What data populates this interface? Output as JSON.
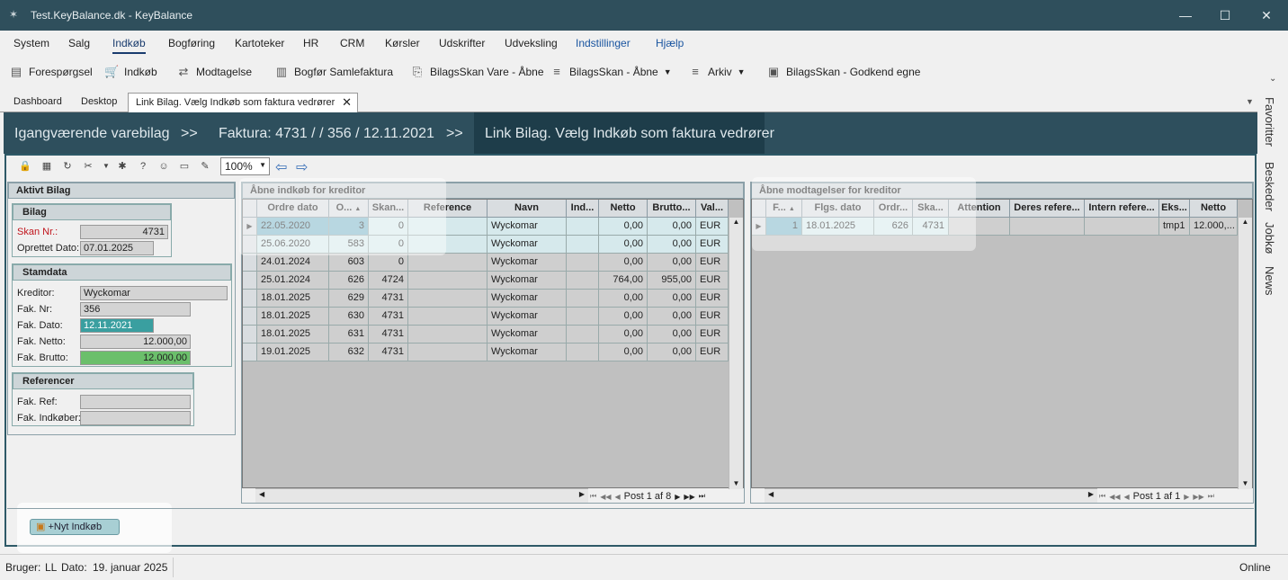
{
  "window": {
    "title": "Test.KeyBalance.dk - KeyBalance"
  },
  "menu": [
    "System",
    "Salg",
    "Indkøb",
    "Bogføring",
    "Kartoteker",
    "HR",
    "CRM",
    "Kørsler",
    "Udskrifter",
    "Udveksling",
    "Indstillinger",
    "Hjælp"
  ],
  "toolbar": [
    "Forespørgsel",
    "Indkøb",
    "Modtagelse",
    "Bogfør Samlefaktura",
    "BilagsSkan Vare - Åbne",
    "BilagsSkan - Åbne",
    "Arkiv",
    "BilagsSkan - Godkend egne"
  ],
  "tabs": [
    "Dashboard",
    "Desktop",
    "Link Bilag. Vælg Indkøb som faktura vedrører"
  ],
  "breadcrumb": {
    "b1": "Igangværende varebilag",
    "sep": ">>",
    "b2": "Faktura: 4731 /  / 356 / 12.11.2021",
    "b3": "Link Bilag. Vælg Indkøb som faktura vedrører"
  },
  "zoom": "100%",
  "left": {
    "title": "Aktivt Bilag",
    "bilag": {
      "header": "Bilag",
      "skan_label": "Skan Nr.:",
      "skan_value": "4731",
      "oprettet_label": "Oprettet Dato:",
      "oprettet_value": "07.01.2025"
    },
    "stamdata": {
      "header": "Stamdata",
      "kreditor_label": "Kreditor:",
      "kreditor_value": "Wyckomar",
      "faknr_label": "Fak. Nr:",
      "faknr_value": "356",
      "fakdato_label": "Fak. Dato:",
      "fakdato_value": "12.11.2021",
      "faknetto_label": "Fak. Netto:",
      "faknetto_value": "12.000,00",
      "fakbrutto_label": "Fak. Brutto:",
      "fakbrutto_value": "12.000,00"
    },
    "referencer": {
      "header": "Referencer",
      "ref_label": "Fak. Ref:",
      "ref_value": "",
      "indkober_label": "Fak. Indkøber:",
      "indkober_value": ""
    }
  },
  "grid1": {
    "title": "Åbne indkøb for kreditor",
    "headers": [
      "Ordre dato",
      "O...",
      "Skan...",
      "Reference",
      "Navn",
      "Ind...",
      "Netto",
      "Brutto...",
      "Val..."
    ],
    "rows": [
      [
        "22.05.2020",
        "3",
        "0",
        "",
        "Wyckomar",
        "",
        "0,00",
        "0,00",
        "EUR"
      ],
      [
        "25.06.2020",
        "583",
        "0",
        "",
        "Wyckomar",
        "",
        "0,00",
        "0,00",
        "EUR"
      ],
      [
        "24.01.2024",
        "603",
        "0",
        "",
        "Wyckomar",
        "",
        "0,00",
        "0,00",
        "EUR"
      ],
      [
        "25.01.2024",
        "626",
        "4724",
        "",
        "Wyckomar",
        "",
        "764,00",
        "955,00",
        "EUR"
      ],
      [
        "18.01.2025",
        "629",
        "4731",
        "",
        "Wyckomar",
        "",
        "0,00",
        "0,00",
        "EUR"
      ],
      [
        "18.01.2025",
        "630",
        "4731",
        "",
        "Wyckomar",
        "",
        "0,00",
        "0,00",
        "EUR"
      ],
      [
        "18.01.2025",
        "631",
        "4731",
        "",
        "Wyckomar",
        "",
        "0,00",
        "0,00",
        "EUR"
      ],
      [
        "19.01.2025",
        "632",
        "4731",
        "",
        "Wyckomar",
        "",
        "0,00",
        "0,00",
        "EUR"
      ]
    ],
    "pager": "Post 1 af 8"
  },
  "grid2": {
    "title": "Åbne modtagelser for kreditor",
    "headers": [
      "F...",
      "Flgs. dato",
      "Ordr...",
      "Ska...",
      "Attention",
      "Deres refere...",
      "Intern refere...",
      "Eks...",
      "Netto"
    ],
    "rows": [
      [
        "1",
        "18.01.2025",
        "626",
        "4731",
        "",
        "",
        "",
        "tmp1",
        "12.000,..."
      ]
    ],
    "pager": "Post 1 af 1"
  },
  "button_nyt": "+Nyt Indkøb",
  "side_tabs": [
    "Favoritter",
    "Beskeder",
    "Jobkø",
    "News"
  ],
  "status": {
    "bruger_label": "Bruger:",
    "bruger": "LL",
    "dato_label": "Dato:",
    "dato": "19. januar 2025",
    "online": "Online"
  }
}
